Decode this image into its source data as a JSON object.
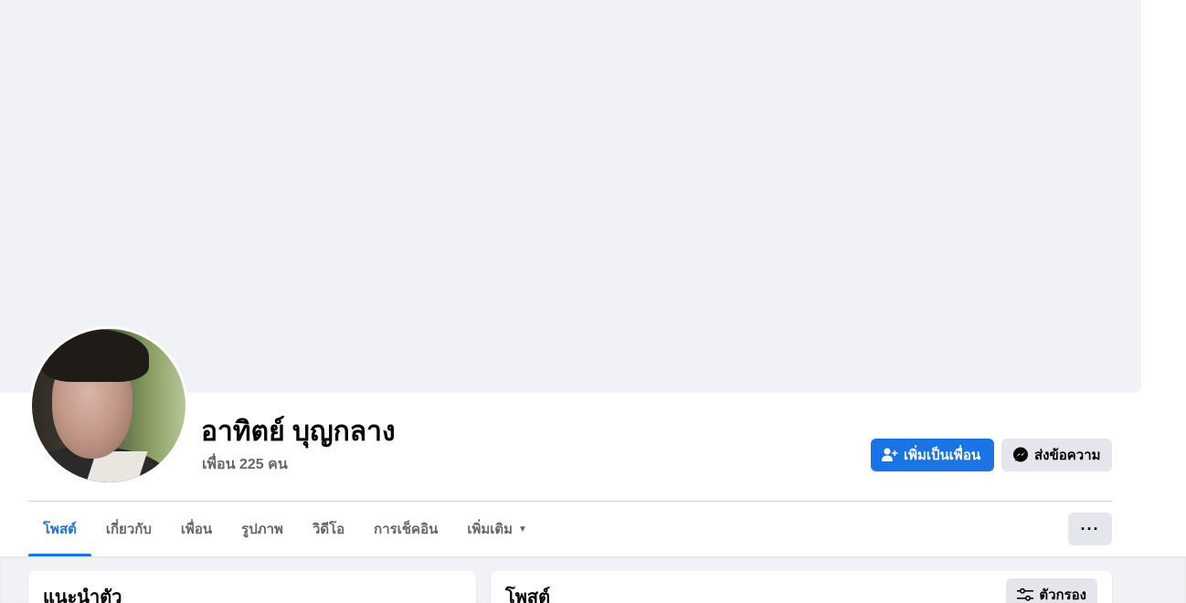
{
  "profile": {
    "name": "อาทิตย์ บุญกลาง",
    "friends_count_text": "เพื่อน 225 คน"
  },
  "actions": {
    "add_friend_label": "เพิ่มเป็นเพื่อน",
    "message_label": "ส่งข้อความ",
    "more_label": "···"
  },
  "tabs": [
    {
      "label": "โพสต์",
      "active": true
    },
    {
      "label": "เกี่ยวกับ",
      "active": false
    },
    {
      "label": "เพื่อน",
      "active": false
    },
    {
      "label": "รูปภาพ",
      "active": false
    },
    {
      "label": "วิดีโอ",
      "active": false
    },
    {
      "label": "การเช็คอิน",
      "active": false
    },
    {
      "label": "เพิ่มเติม",
      "active": false
    }
  ],
  "intro_card": {
    "title": "แนะนำตัว"
  },
  "posts_card": {
    "title": "โพสต์",
    "filter_label": "ตัวกรอง"
  },
  "colors": {
    "accent": "#1b74e4",
    "cover_bg": "#f0f2f5",
    "secondary_button": "#e4e6eb",
    "muted_text": "#65676b"
  }
}
